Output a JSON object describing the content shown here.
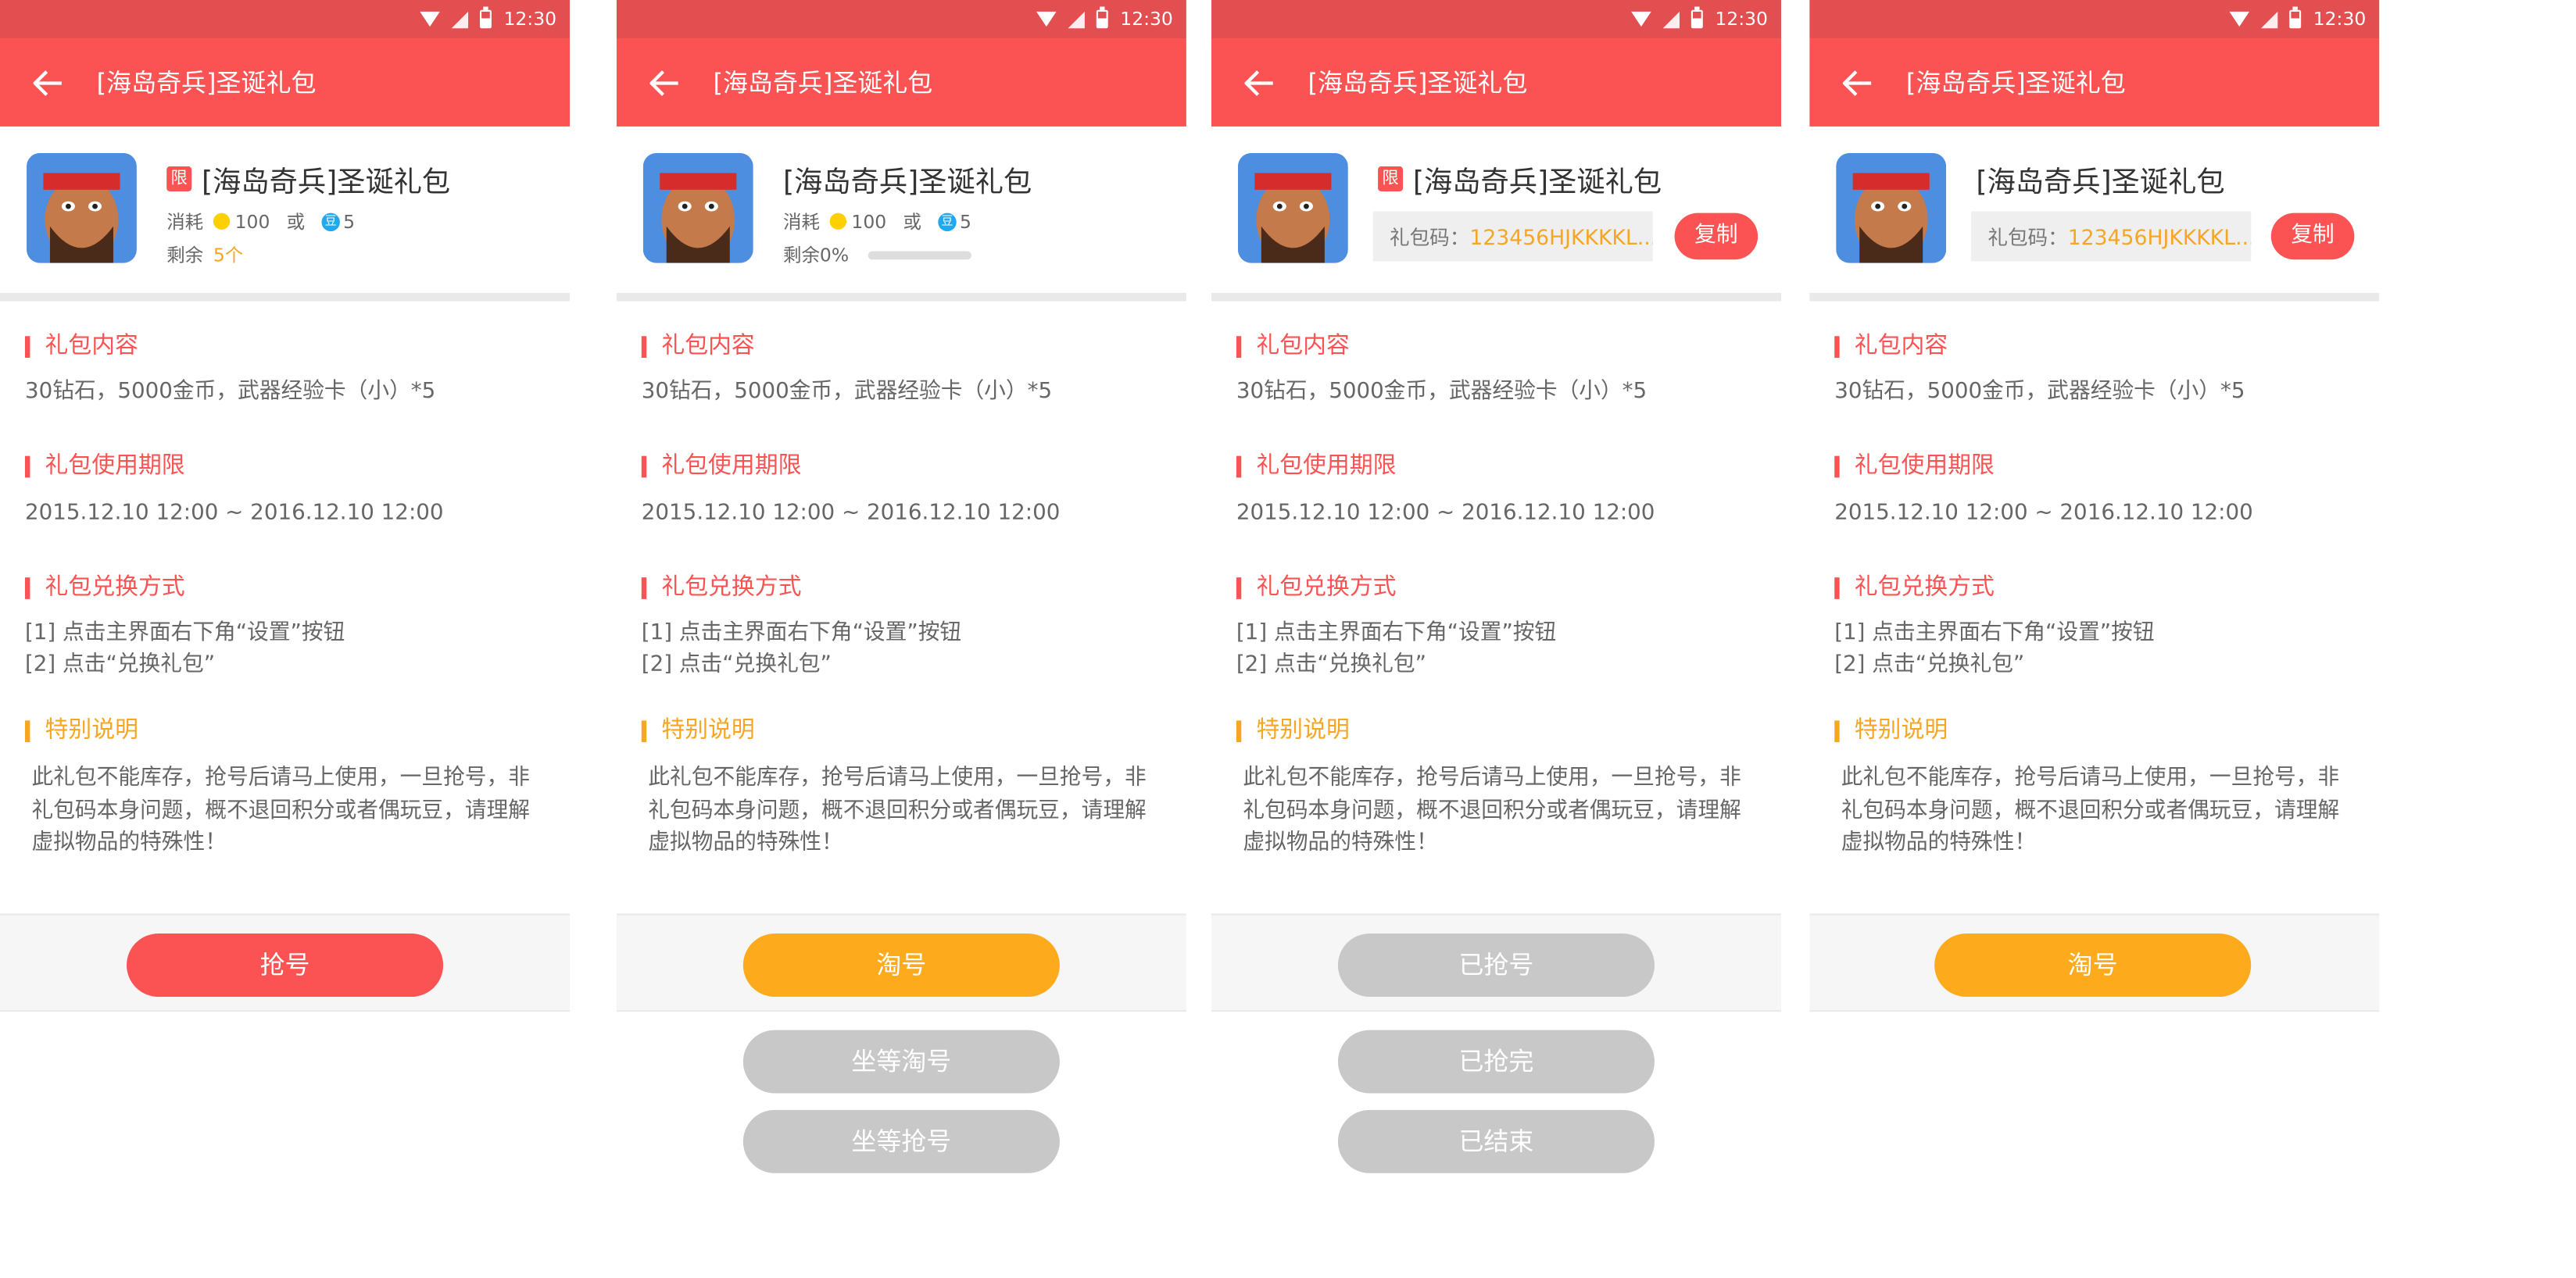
{
  "status_bar": {
    "time": "12:30"
  },
  "common": {
    "app_title": "[海岛奇兵]圣诞礼包",
    "game_name": "[海岛奇兵]圣诞礼包",
    "limit_badge": "限",
    "cost_label": "消耗",
    "coin_amount": "100",
    "or_label": "或",
    "bean_glyph": "豆",
    "bean_amount": "5",
    "remain_label": "剩余",
    "remain_count": "5个",
    "remain_percent_label": "剩余0%",
    "remain_percent_value": 0,
    "code_label": "礼包码：",
    "code_value": "123456HJKKKKL...",
    "copy_button": "复制",
    "section_content_title": "礼包内容",
    "section_content_text": "30钻石，5000金币，武器经验卡（小）*5",
    "section_period_title": "礼包使用期限",
    "section_period_text": "2015.12.10  12:00 ~ 2016.12.10  12:00",
    "section_redeem_title": "礼包兑换方式",
    "section_redeem_step1": "[1] 点击主界面右下角“设置”按钮",
    "section_redeem_step2": "[2] 点击“兑换礼包”",
    "section_special_title": "特别说明",
    "section_special_text": "此礼包不能库存，抢号后请马上使用，一旦抢号，非礼包码本身问题，概不退回积分或者偶玩豆，请理解虚拟物品的特殊性！"
  },
  "screens": [
    {
      "primary_button": "抢号"
    },
    {
      "primary_button": "淘号",
      "extra_buttons": [
        "坐等淘号",
        "坐等抢号"
      ]
    },
    {
      "primary_button": "已抢号",
      "extra_buttons": [
        "已抢完",
        "已结束"
      ]
    },
    {
      "primary_button": "淘号"
    }
  ],
  "colors": {
    "status_bar": "#e34e50",
    "app_bar": "#fb5353",
    "accent_red": "#fb5353",
    "accent_orange": "#fdab1d",
    "disabled_grey": "#c8c8c8"
  },
  "icons": [
    "back-arrow-icon",
    "wifi-icon",
    "signal-icon",
    "battery-icon",
    "coin-icon",
    "bean-icon",
    "game-avatar-icon"
  ]
}
